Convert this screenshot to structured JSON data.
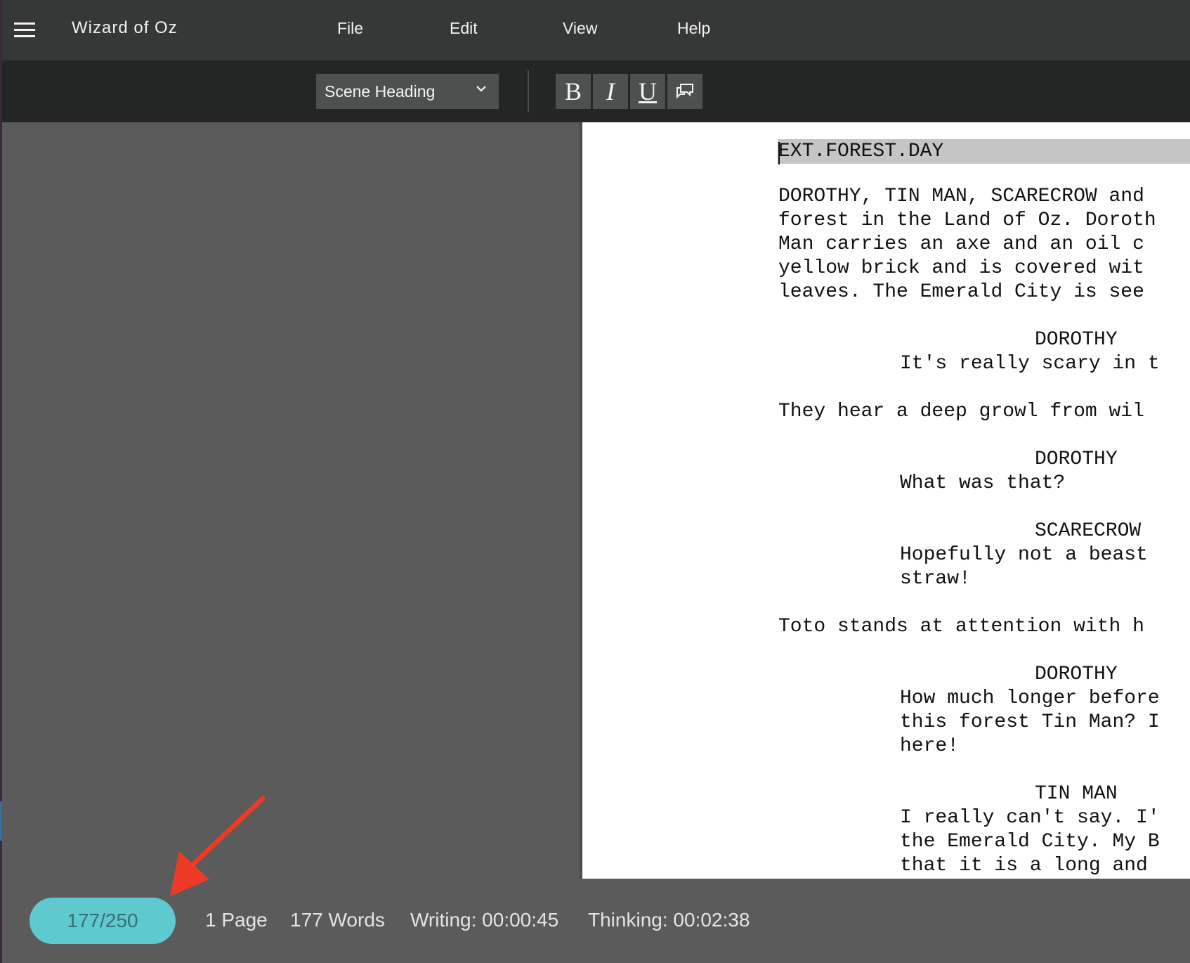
{
  "app": {
    "title": "Wizard of Oz"
  },
  "menu": {
    "items": [
      "File",
      "Edit",
      "View",
      "Help"
    ]
  },
  "toolbar": {
    "element_style": "Scene Heading",
    "bold": "B",
    "italic": "I",
    "underline": "U"
  },
  "script": {
    "lines": [
      "EXT.FOREST.DAY",
      "DOROTHY, TIN MAN, SCARECROW and",
      "forest in the Land of Oz. Doroth",
      "Man carries an axe and an oil c",
      "yellow brick and is covered wit",
      "leaves. The Emerald City is see",
      "DOROTHY",
      "It's really scary in t",
      "They hear a deep growl from wil",
      "DOROTHY",
      "What was that?",
      "SCARECROW",
      "Hopefully not a beast",
      "straw!",
      "Toto stands at attention with h",
      "DOROTHY",
      "How much longer before",
      "this forest Tin Man? I",
      "here!",
      "TIN MAN",
      "I really can't say. I'",
      "the Emerald City. My B",
      "that it is a long and"
    ]
  },
  "status": {
    "word_goal": "177/250",
    "pages": "1 Page",
    "words": "177 Words",
    "writing": "Writing: 00:00:45",
    "thinking": "Thinking: 00:02:38"
  },
  "colors": {
    "menubar": "#363737",
    "toolbar": "#242625",
    "pill": "#5fc9cf",
    "annotation_arrow": "#ee3a24"
  },
  "icons": {
    "menu": "hamburger-icon",
    "dropdown": "chevron-down-icon",
    "comment": "comment-icon",
    "annotation": "arrow-icon"
  }
}
